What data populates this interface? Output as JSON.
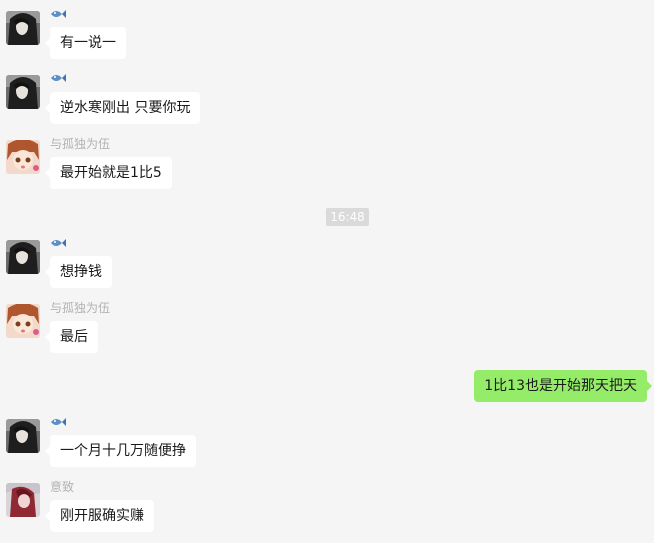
{
  "timestamp": "16:48",
  "messages": [
    {
      "sender": "fish-icon",
      "avatar": "avatar-dark-hair",
      "text": "有一说一"
    },
    {
      "sender": "fish-icon",
      "avatar": "avatar-dark-hair",
      "text": "逆水寒刚出 只要你玩"
    },
    {
      "sender": "与孤独为伍",
      "avatar": "avatar-anime-girl",
      "text": "最开始就是1比5"
    },
    {
      "sender": "fish-icon",
      "avatar": "avatar-dark-hair",
      "text": "想挣钱"
    },
    {
      "sender": "与孤独为伍",
      "avatar": "avatar-anime-girl",
      "text": "最后"
    },
    {
      "mine": true,
      "text": "1比13也是开始那天把天"
    },
    {
      "sender": "fish-icon",
      "avatar": "avatar-dark-hair",
      "text": "一个月十几万随便挣"
    },
    {
      "sender": "意致",
      "avatar": "avatar-red-character",
      "text": "刚开服确实赚"
    }
  ],
  "colors": {
    "background": "#f5f5f5",
    "incoming_bubble": "#ffffff",
    "outgoing_bubble": "#95ec69",
    "sender_name": "#b2b2b2",
    "timestamp_bg": "#dadada"
  }
}
